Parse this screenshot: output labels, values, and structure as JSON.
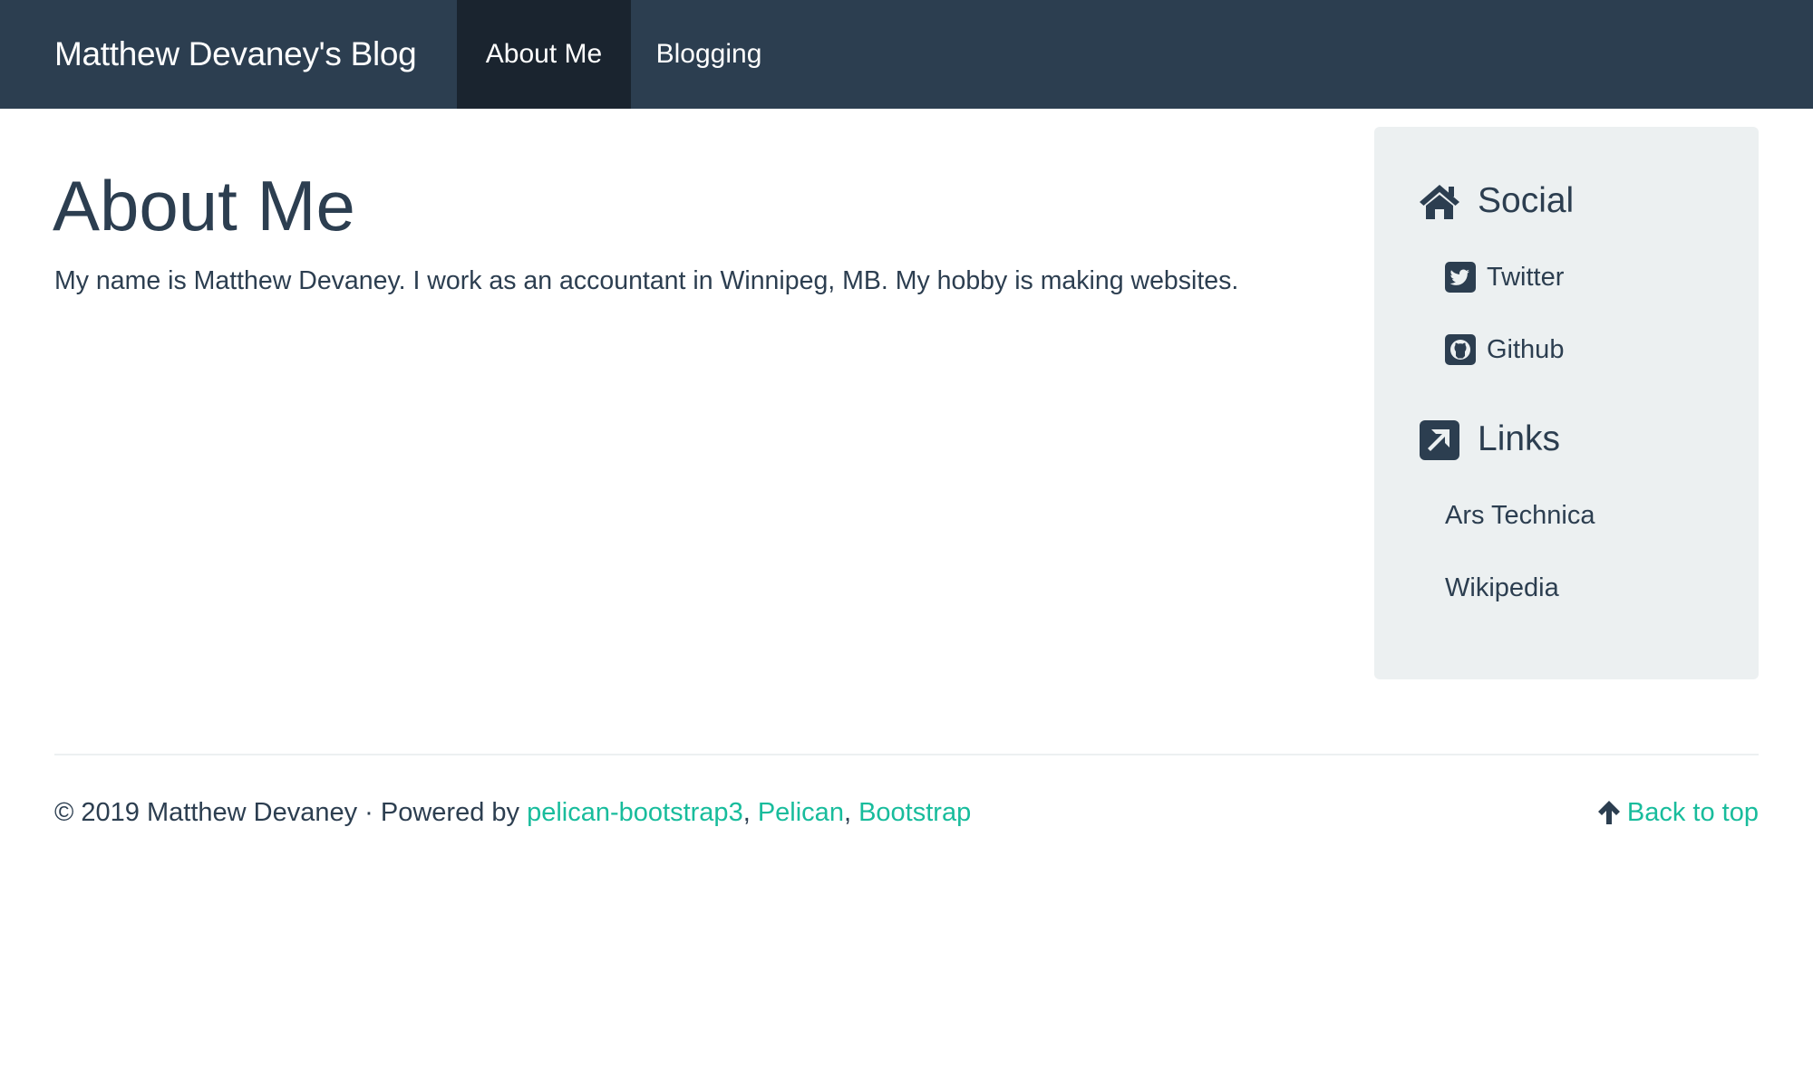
{
  "navbar": {
    "brand": "Matthew Devaney's Blog",
    "items": [
      {
        "label": "About Me",
        "active": true
      },
      {
        "label": "Blogging",
        "active": false
      }
    ],
    "background_color": "#2c3e50",
    "active_color": "#1a242f"
  },
  "main": {
    "title": "About Me",
    "intro": "My name is Matthew Devaney. I work as an accountant in Winnipeg, MB. My hobby is making websites."
  },
  "sidebar": {
    "social": {
      "heading": "Social",
      "icon": "home-icon",
      "items": [
        {
          "label": "Twitter",
          "icon": "twitter-square-icon"
        },
        {
          "label": "Github",
          "icon": "github-square-icon"
        }
      ]
    },
    "links": {
      "heading": "Links",
      "icon": "external-link-square-icon",
      "items": [
        {
          "label": "Ars Technica"
        },
        {
          "label": "Wikipedia"
        }
      ]
    },
    "background_color": "#ecf0f1"
  },
  "footer": {
    "copyright": "© 2019 Matthew Devaney · Powered by ",
    "links": [
      {
        "label": "pelican-bootstrap3"
      },
      {
        "label": "Pelican"
      },
      {
        "label": "Bootstrap"
      }
    ],
    "separator": ", ",
    "back_to_top": "Back to top",
    "back_to_top_icon": "arrow-up-icon",
    "link_color": "#18bc9c"
  }
}
